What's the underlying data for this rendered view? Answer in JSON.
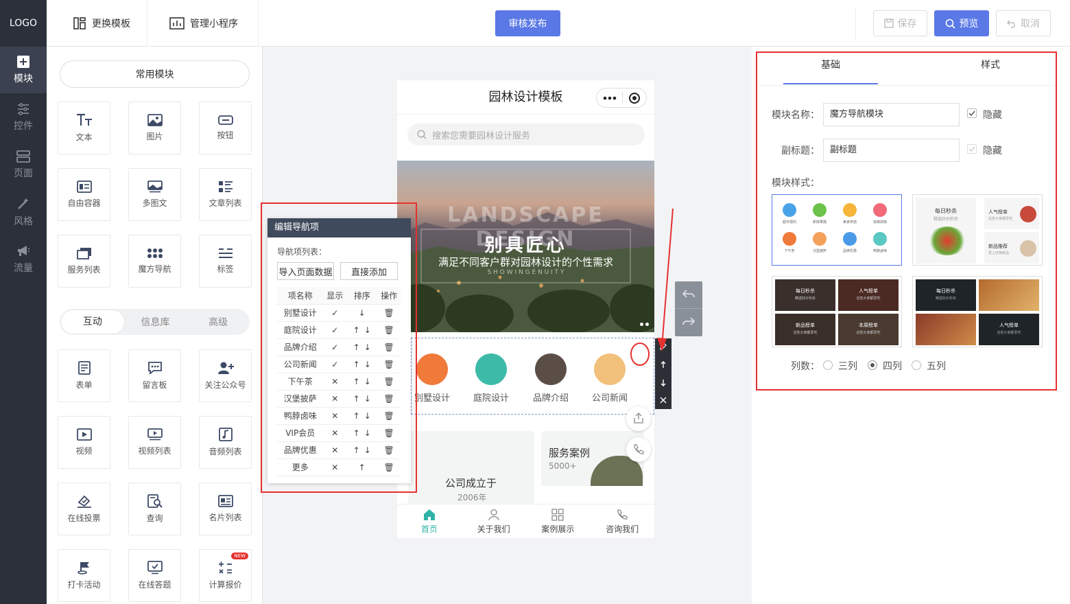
{
  "topbar": {
    "logo": "LOGO",
    "change_template": "更换模板",
    "manage_miniprogram": "管理小程序",
    "publish": "审核发布",
    "save": "保存",
    "preview": "预览",
    "cancel": "取消"
  },
  "rail": [
    "模块",
    "控件",
    "页面",
    "风格",
    "流量"
  ],
  "widgets": {
    "common_label": "常用模块",
    "common": [
      "文本",
      "图片",
      "按钮",
      "自由容器",
      "多图文",
      "文章列表",
      "服务列表",
      "魔方导航",
      "标签"
    ],
    "tabs": [
      "互动",
      "信息库",
      "高级"
    ],
    "interactive": [
      "表单",
      "留言板",
      "关注公众号",
      "视频",
      "视频列表",
      "音频列表",
      "在线投票",
      "查询",
      "名片列表",
      "打卡活动",
      "在线答题",
      "计算报价"
    ],
    "new_badge": "NEW"
  },
  "phone": {
    "title": "园林设计模板",
    "search_placeholder": "搜索您需要园林设计服务",
    "banner_bg_text": "LANDSCAPE DESIGN",
    "banner_title": "别具匠心",
    "banner_subtitle": "满足不同客户群对园林设计的个性需求",
    "banner_small": "S H O W   I N G E N U I T Y",
    "nav": [
      "别墅设计",
      "庭院设计",
      "品牌介绍",
      "公司新闻"
    ],
    "card1_title": "公司成立于",
    "card1_sub": "2006年",
    "card2_title": "服务案例",
    "card2_sub": "5000+",
    "tabbar": [
      "首页",
      "关于我们",
      "案例展示",
      "咨询我们"
    ]
  },
  "editor": {
    "title": "编辑导航项",
    "list_label": "导航项列表：",
    "import_btn": "导入页面数据",
    "add_btn": "直接添加",
    "headers": [
      "项名称",
      "显示",
      "排序",
      "操作"
    ],
    "rows": [
      {
        "name": "别墅设计",
        "show": "✓"
      },
      {
        "name": "庭院设计",
        "show": "✓"
      },
      {
        "name": "品牌介绍",
        "show": "✓"
      },
      {
        "name": "公司新闻",
        "show": "✓"
      },
      {
        "name": "下午茶",
        "show": "✕"
      },
      {
        "name": "汉堡披萨",
        "show": "✕"
      },
      {
        "name": "鸭脖卤味",
        "show": "✕"
      },
      {
        "name": "VIP会员",
        "show": "✕"
      },
      {
        "name": "品牌优惠",
        "show": "✕"
      },
      {
        "name": "更多",
        "show": "✕"
      }
    ]
  },
  "props": {
    "tab_basic": "基础",
    "tab_style": "样式",
    "name_label": "模块名称：",
    "name_value": "魔方导航模块",
    "hide1": "隐藏",
    "subtitle_label": "副标题：",
    "subtitle_value": "副标题",
    "hide2": "隐藏",
    "style_label": "模块样式：",
    "icons_row1": [
      "超市便利",
      "新鲜果蔬",
      "美食烘焙",
      "烧烤涮锅"
    ],
    "icons_row2": [
      "下午茶",
      "汉堡披萨",
      "品牌优惠",
      "鸭脖卤味"
    ],
    "s2": [
      "每日秒杀",
      "精选好价秒杀",
      "人气榜单",
      "这些大家都爱吃",
      "新品推荐",
      "爱上好物新品"
    ],
    "s3": [
      "每日秒杀",
      "精选好价秒杀",
      "人气榜单",
      "这些大家都爱吃",
      "新品榜单",
      "这些大家都爱吃",
      "本周榜单",
      "这些大家都爱吃"
    ],
    "s4": [
      "每日秒杀",
      "精选好价秒杀",
      "人气榜单",
      "这些大家都爱吃"
    ],
    "columns_label": "列数：",
    "col3": "三列",
    "col4": "四列",
    "col5": "五列"
  }
}
